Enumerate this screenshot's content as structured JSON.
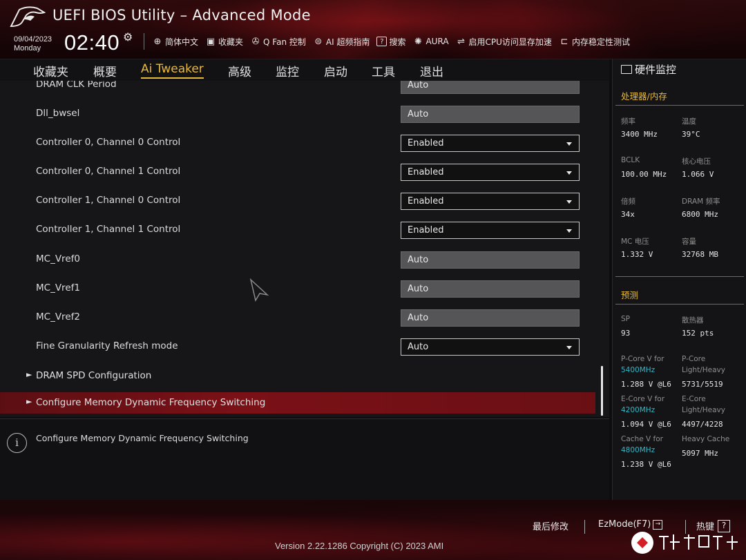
{
  "header": {
    "title": "UEFI BIOS Utility – Advanced Mode",
    "date": "09/04/2023",
    "day": "Monday",
    "time": "02:40",
    "toolbar": [
      {
        "label": "简体中文",
        "icon": "globe-icon"
      },
      {
        "label": "收藏夹",
        "icon": "favorites-icon"
      },
      {
        "label": "Q Fan 控制",
        "icon": "fan-icon"
      },
      {
        "label": "AI 超频指南",
        "icon": "ai-overclock-icon"
      },
      {
        "label": "搜索",
        "icon": "search-box-icon"
      },
      {
        "label": "AURA",
        "icon": "aura-icon"
      },
      {
        "label": "启用CPU访问显存加速",
        "icon": "resize-bar-icon"
      },
      {
        "label": "内存稳定性测试",
        "icon": "memtest-icon"
      }
    ]
  },
  "nav": {
    "tabs": [
      "收藏夹",
      "概要",
      "Ai Tweaker",
      "高级",
      "监控",
      "启动",
      "工具",
      "退出"
    ],
    "active": "Ai Tweaker"
  },
  "settings": {
    "partial_row": {
      "label": "DRAM CLK Period",
      "value": "Auto"
    },
    "rows": [
      {
        "label": "Dll_bwsel",
        "value": "Auto",
        "type": "auto"
      },
      {
        "label": "Controller 0, Channel 0 Control",
        "value": "Enabled",
        "type": "dropdown"
      },
      {
        "label": "Controller 0, Channel 1 Control",
        "value": "Enabled",
        "type": "dropdown"
      },
      {
        "label": "Controller 1, Channel 0 Control",
        "value": "Enabled",
        "type": "dropdown"
      },
      {
        "label": "Controller 1, Channel 1 Control",
        "value": "Enabled",
        "type": "dropdown"
      },
      {
        "label": "MC_Vref0",
        "value": "Auto",
        "type": "auto"
      },
      {
        "label": "MC_Vref1",
        "value": "Auto",
        "type": "auto"
      },
      {
        "label": "MC_Vref2",
        "value": "Auto",
        "type": "auto"
      },
      {
        "label": "Fine Granularity Refresh mode",
        "value": "Auto",
        "type": "dropdown"
      }
    ],
    "submenus": [
      {
        "label": "DRAM SPD Configuration",
        "selected": false
      },
      {
        "label": "Configure Memory Dynamic Frequency Switching",
        "selected": true
      }
    ]
  },
  "help": {
    "text": "Configure Memory Dynamic Frequency Switching"
  },
  "monitor": {
    "title": "硬件监控",
    "cpu_section": "处理器/内存",
    "cpu_items": [
      {
        "label": "频率",
        "value": "3400 MHz"
      },
      {
        "label": "温度",
        "value": "39°C"
      },
      {
        "label": "BCLK",
        "value": "100.00 MHz"
      },
      {
        "label": "核心电压",
        "value": "1.066 V"
      },
      {
        "label": "倍频",
        "value": "34x"
      },
      {
        "label": "DRAM 频率",
        "value": "6800 MHz"
      },
      {
        "label": "MC 电压",
        "value": "1.332 V"
      },
      {
        "label": "容量",
        "value": "32768 MB"
      }
    ],
    "predict_section": "预测",
    "predict": {
      "sp_label": "SP",
      "sp_value": "93",
      "cooler_label": "散热器",
      "cooler_value": "152 pts",
      "pcore_v_label": "P-Core V for",
      "pcore_v_freq": "5400MHz",
      "pcore_v_value": "1.288 V @L6",
      "pcore_lh_label1": "P-Core",
      "pcore_lh_label2": "Light/Heavy",
      "pcore_lh_value": "5731/5519",
      "ecore_v_label": "E-Core V for",
      "ecore_v_freq": "4200MHz",
      "ecore_v_value": "1.094 V @L6",
      "ecore_lh_label1": "E-Core",
      "ecore_lh_label2": "Light/Heavy",
      "ecore_lh_value": "4497/4228",
      "cache_v_label": "Cache V for",
      "cache_v_freq": "4800MHz",
      "cache_v_value": "1.238 V @L6",
      "heavy_cache_label": "Heavy Cache",
      "heavy_cache_value": "5097 MHz"
    }
  },
  "footer": {
    "last_modified": "最后修改",
    "ezmode": "EzMode(F7)",
    "hotkeys": "热键",
    "version": "Version 2.22.1286 Copyright (C) 2023 AMI"
  },
  "colors": {
    "accent": "#e8b93a",
    "selected_row": "#7a1117",
    "frequency": "#2fb9c9"
  }
}
